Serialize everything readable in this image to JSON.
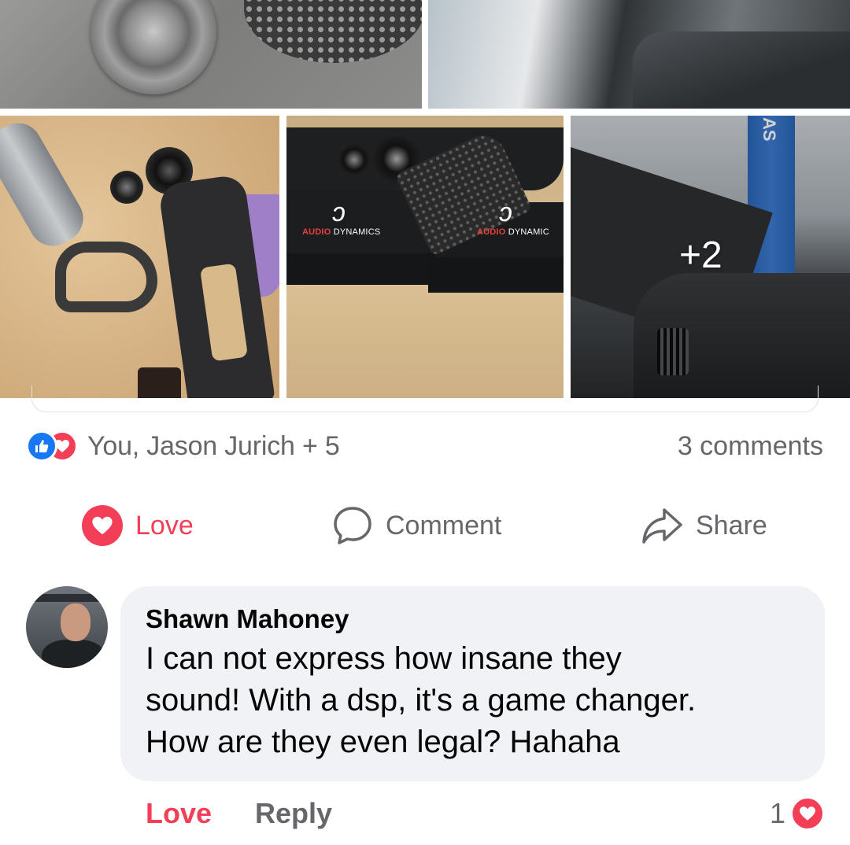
{
  "post": {
    "photos": [
      {
        "name": "tweeter-grille-photo"
      },
      {
        "name": "dashboard-photo"
      },
      {
        "name": "workbench-parts-photo",
        "brand": ""
      },
      {
        "name": "audio-dynamics-boxes-photo",
        "brand_part1": "AUDIO",
        "brand_part2": " DYNAMICS",
        "brand2_part1": "AUDIO",
        "brand2_part2": " DYNAMIC"
      },
      {
        "name": "installed-pillar-photo",
        "lift_text": "AS",
        "more_label": "+2"
      }
    ],
    "reactions": {
      "names": "You, Jason Jurich + 5",
      "types": [
        "like-icon",
        "love-icon"
      ],
      "comment_count": "3 comments"
    },
    "actions": {
      "love_label": "Love",
      "comment_label": "Comment",
      "share_label": "Share"
    }
  },
  "comment": {
    "author": "Shawn Mahoney",
    "lines": [
      "I can not express how insane they",
      "sound!  With a dsp, it's a game changer.",
      "How are they even legal? Hahaha"
    ],
    "love_label": "Love",
    "reply_label": "Reply",
    "reaction_count": "1"
  },
  "colors": {
    "love": "#f33e58",
    "like": "#1877f2",
    "muted_text": "#65676b",
    "bubble": "#f0f2f5"
  }
}
